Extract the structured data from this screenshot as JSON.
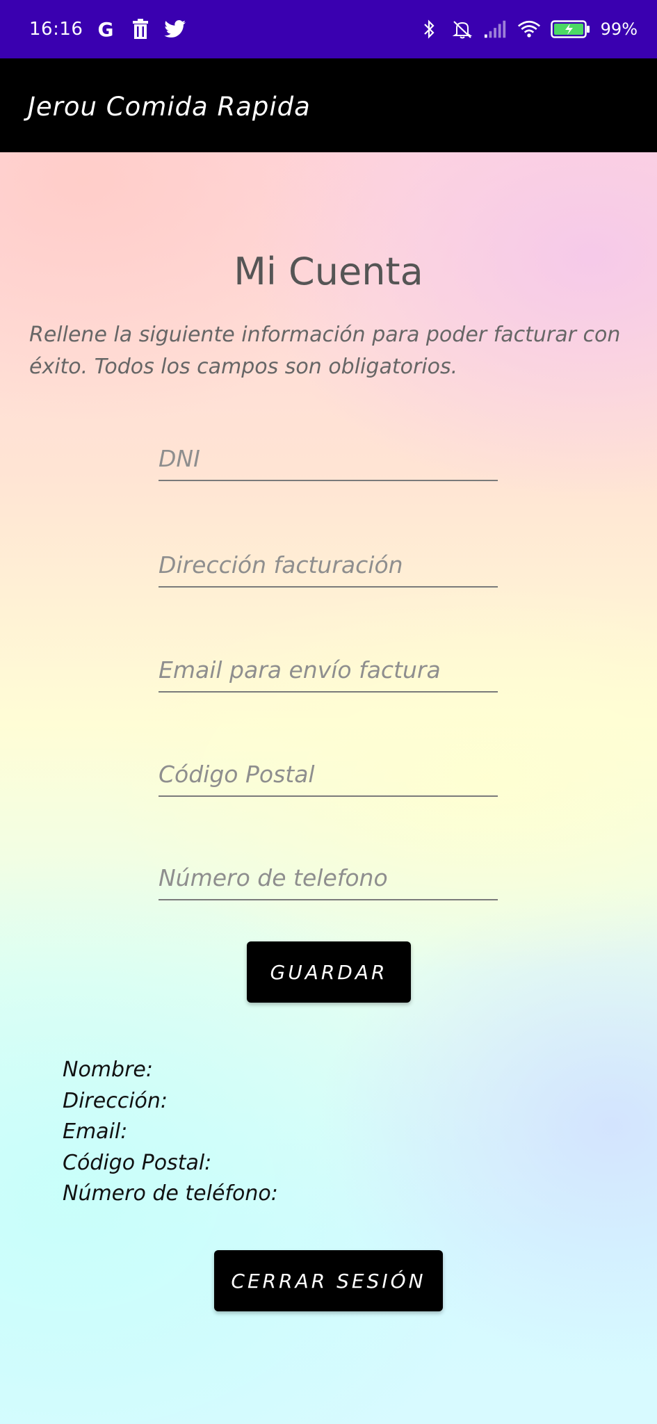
{
  "status_bar": {
    "time": "16:16",
    "battery": "99%",
    "left_icons": [
      "google-icon",
      "trash-icon",
      "twitter-icon"
    ],
    "right_icons": [
      "bluetooth-icon",
      "mute-icon",
      "signal-icon",
      "wifi-icon",
      "battery-icon"
    ],
    "background": "#3a00b0"
  },
  "app_bar": {
    "title": "Jerou Comida Rapida"
  },
  "main": {
    "title": "Mi Cuenta",
    "instructions": "Rellene la siguiente información para poder facturar con éxito. Todos los campos son obligatorios.",
    "fields": {
      "dni": {
        "placeholder": "DNI",
        "value": ""
      },
      "address": {
        "placeholder": "Dirección facturación",
        "value": ""
      },
      "email": {
        "placeholder": "Email para envío factura",
        "value": ""
      },
      "postal_code": {
        "placeholder": "Código Postal",
        "value": ""
      },
      "phone": {
        "placeholder": "Número de telefono",
        "value": ""
      }
    },
    "save_label": "GUARDAR",
    "info": {
      "name": "Nombre:",
      "address": "Dirección:",
      "email": "Email:",
      "postal_code": "Código Postal:",
      "phone": "Número de teléfono:"
    },
    "logout_label": "CERRAR SESIÓN"
  }
}
